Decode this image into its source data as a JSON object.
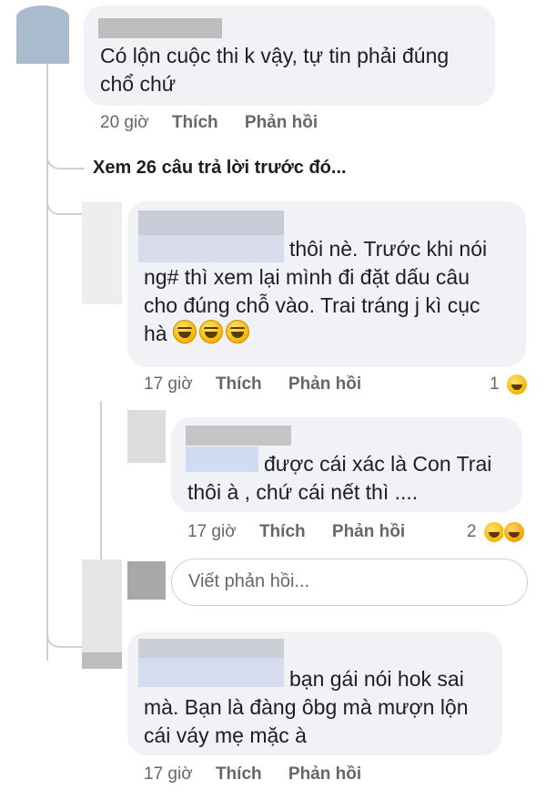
{
  "comment1": {
    "text_line1": "Có lộn cuộc thi k vậy, tự tin phải đúng",
    "text_line2": "chổ chứ",
    "time": "20 giờ",
    "like": "Thích",
    "reply": "Phản hồi"
  },
  "view_previous": "Xem 26 câu trả lời trước đó...",
  "reply1": {
    "line1": "thôi nè. Trước khi nói",
    "line2": "ng# thì xem lại mình đi đặt dấu câu",
    "line3": "cho đúng chỗ vào. Trai tráng j kì cục",
    "line4": "hà",
    "time": "17 giờ",
    "like": "Thích",
    "reply": "Phản hồi",
    "reaction_count": "1"
  },
  "reply2": {
    "line1": "được cái xác là Con Trai",
    "line2": "thôi à , chứ cái nết thì ....",
    "time": "17 giờ",
    "like": "Thích",
    "reply": "Phản hồi",
    "reaction_count": "2"
  },
  "reply_input": {
    "placeholder": "Viết phản hồi..."
  },
  "reply3": {
    "line1": "bạn gái nói hok sai",
    "line2": "mà. Bạn là đàng ôbg mà mượn lộn",
    "line3": "cái váy mẹ mặc à",
    "time": "17 giờ",
    "like": "Thích",
    "reply": "Phản hồi"
  },
  "colors": {
    "bubble": "#f0f2f5",
    "meta": "#65676b",
    "text": "#1c1e21",
    "thread_line": "#ced0d4"
  }
}
